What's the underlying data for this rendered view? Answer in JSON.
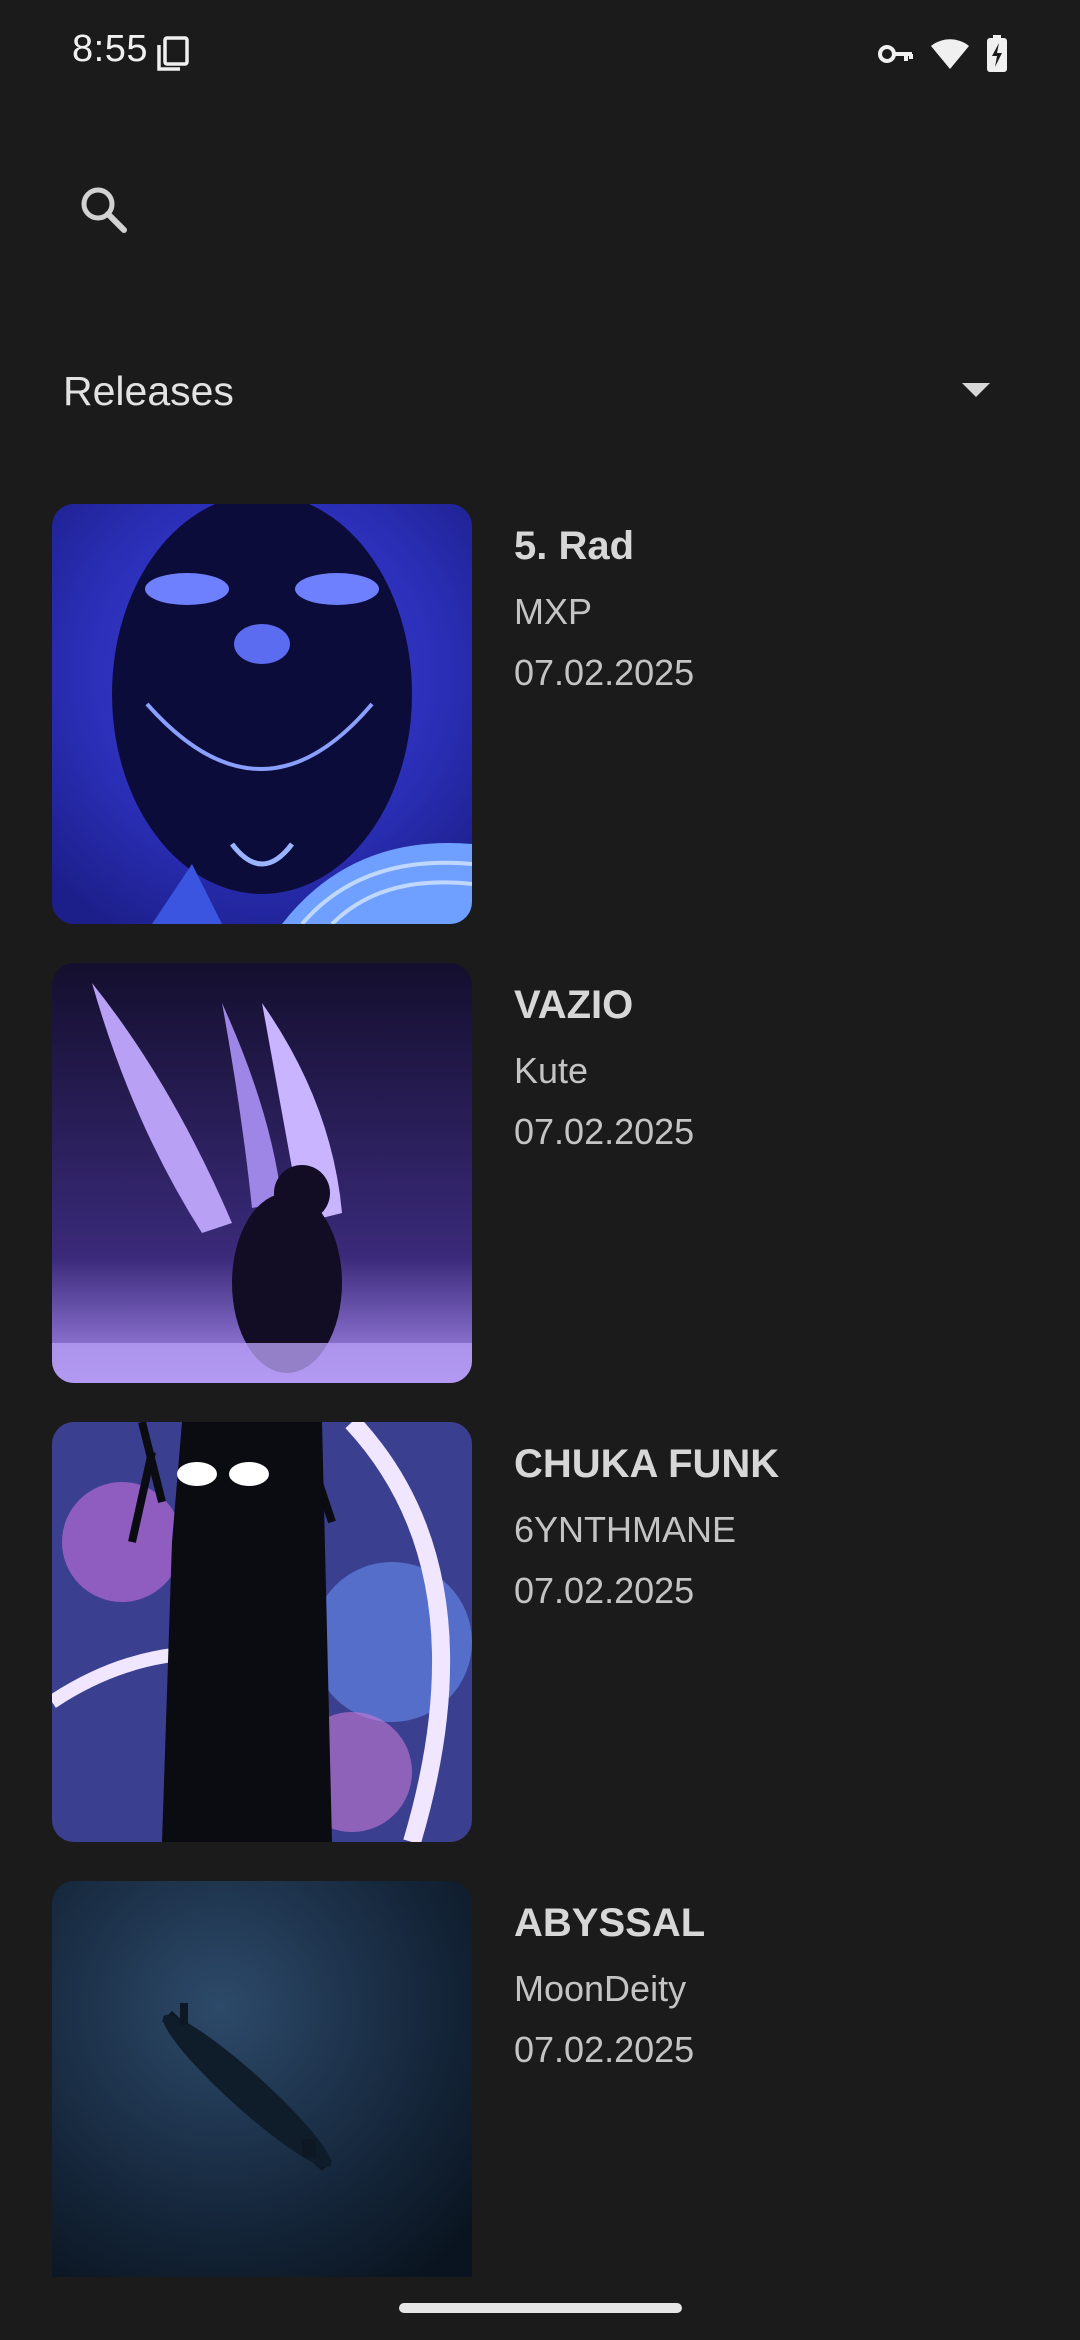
{
  "status_bar": {
    "time": "8:55",
    "icons": [
      "screenshot-icon",
      "vpn-key-icon",
      "wifi-icon",
      "battery-charging-icon"
    ]
  },
  "search": {
    "icon": "search-icon"
  },
  "filter": {
    "label": "Releases",
    "icon": "dropdown-arrow-icon"
  },
  "releases": [
    {
      "title": "5. Rad",
      "artist": "MXP",
      "date": "07.02.2025"
    },
    {
      "title": "VAZIO",
      "artist": "Kute",
      "date": "07.02.2025"
    },
    {
      "title": "CHUKA FUNK",
      "artist": "6YNTHMANE",
      "date": "07.02.2025"
    },
    {
      "title": "ABYSSAL",
      "artist": "MoonDeity",
      "date": "07.02.2025"
    }
  ],
  "colors": {
    "background": "#1b1b1b",
    "text_primary": "#d7d7d7",
    "text_secondary": "#c4c4c4"
  }
}
